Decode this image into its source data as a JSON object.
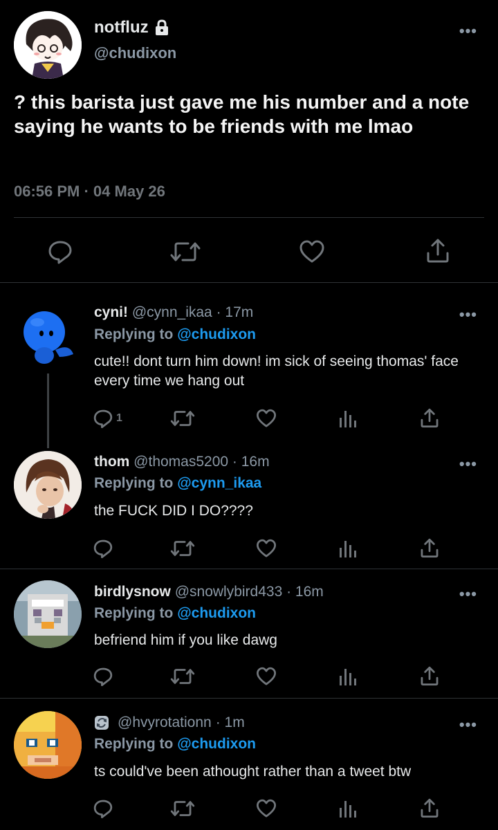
{
  "main_tweet": {
    "display_name": "notfluz",
    "lock_icon": "lock-icon",
    "handle": "@chudixon",
    "text": "? this barista just gave me his number and a note saying he wants to be friends with me lmao",
    "timestamp": "06:56 PM · 04 May 26",
    "menu_icon": "more-dots-icon"
  },
  "replies": [
    {
      "display_name": "cyni!",
      "handle": "@cynn_ikaa",
      "time": "· 17m",
      "replying_prefix": "Replying to",
      "replying_to": "@chudixon",
      "text": "cute!! dont turn him down! im sick of seeing thomas' face every time we hang out",
      "reply_count": "1"
    },
    {
      "display_name": "thom",
      "handle": "@thomas5200",
      "time": "· 16m",
      "replying_prefix": "Replying to",
      "replying_to": "@cynn_ikaa",
      "text": "the FUCK DID I DO????",
      "reply_count": ""
    },
    {
      "display_name": "birdlysnow",
      "handle": "@snowlybird433",
      "time": "· 16m",
      "replying_prefix": "Replying to",
      "replying_to": "@chudixon",
      "text": "befriend him if you like dawg",
      "reply_count": ""
    },
    {
      "display_name": "",
      "handle": "@hvyrotationn",
      "time": "· 1m",
      "replying_prefix": "Replying to",
      "replying_to": "@chudixon",
      "text": "ts could've been  athought rather than a tweet btw",
      "reply_count": ""
    }
  ],
  "colors": {
    "background": "#000000",
    "text": "#e7e9ea",
    "secondary": "#71767b",
    "accent": "#1d9bf0",
    "divider": "#2f3336"
  }
}
